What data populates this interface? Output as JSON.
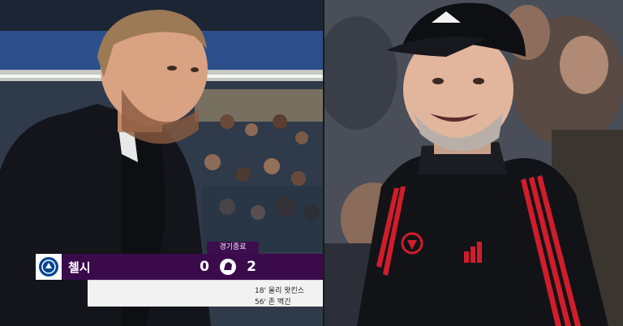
{
  "scoreboard": {
    "status_label": "경기종료",
    "home_team": "첼시",
    "home_score": "0",
    "away_score": "2",
    "scorers": [
      "18' 올리 왓킨스",
      "56' 존 맥긴"
    ]
  },
  "colors": {
    "scoreboard_purple": "#3a0a4b",
    "chelsea_blue": "#034694"
  },
  "icons": [
    "chelsea-crest-icon",
    "premier-league-lion-icon",
    "adidas-logo-icon",
    "bayern-crest-icon"
  ]
}
